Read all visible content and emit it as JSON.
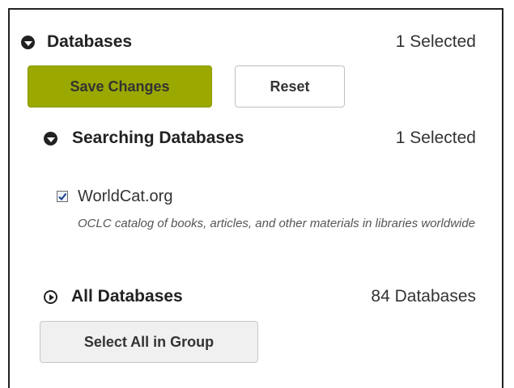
{
  "databases": {
    "heading": "Databases",
    "selected_count": "1 Selected",
    "icon": "circle-chevron-down-icon"
  },
  "actions": {
    "save_label": "Save Changes",
    "reset_label": "Reset"
  },
  "searching": {
    "heading": "Searching Databases",
    "selected_count": "1 Selected",
    "icon": "circle-chevron-down-icon",
    "items": [
      {
        "name": "WorldCat.org",
        "checked": true,
        "description": "OCLC catalog of books, articles, and other materials in libraries worldwide"
      }
    ]
  },
  "all_databases": {
    "heading": "All Databases",
    "count": "84 Databases",
    "icon": "circle-chevron-right-icon",
    "select_all_label": "Select All in Group"
  },
  "colors": {
    "save_button": "#9aa800",
    "text": "#333333",
    "border": "#222222"
  }
}
